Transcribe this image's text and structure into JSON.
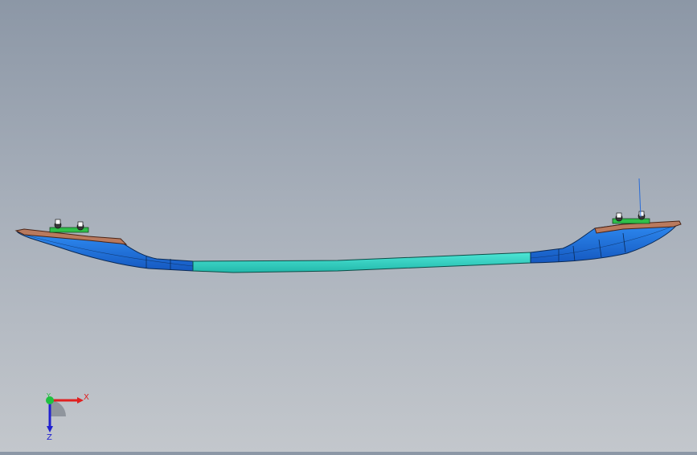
{
  "colors": {
    "background_top": "#8c97a6",
    "background_bottom": "#c3c7cc",
    "beam_blue": "#1f74e6",
    "beam_blue_dark": "#1558c0",
    "beam_cyan": "#2fd2c4",
    "bracket_copper": "#b97a5e",
    "fastener_green": "#2fbf4a",
    "x_axis": "#e02020",
    "y_axis": "#20c040",
    "z_axis": "#2020d0"
  },
  "triad": {
    "x_label": "X",
    "y_label": "Y",
    "z_label": "Z"
  },
  "icons": {
    "triad": "coordinate-triad-icon"
  }
}
